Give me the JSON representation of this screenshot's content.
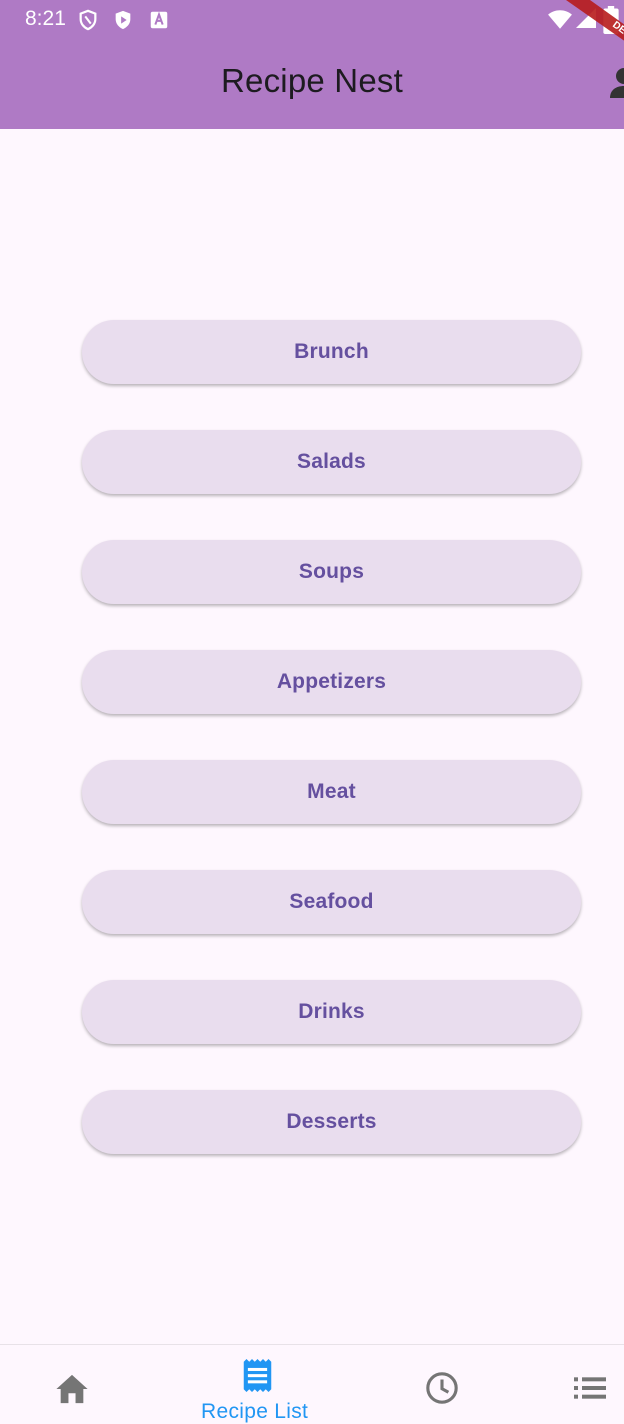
{
  "status_bar": {
    "time": "8:21",
    "icons": [
      "shield-icon",
      "play-protect-icon",
      "font-icon",
      "wifi-icon",
      "signal-icon",
      "battery-icon"
    ]
  },
  "debug_ribbon": {
    "label": "DEBUG"
  },
  "app_bar": {
    "title": "Recipe Nest",
    "background_color": "#AF7AC5",
    "profile_icon": "person-icon"
  },
  "categories": {
    "button_color": "#E9DDEE",
    "text_color": "#65509F",
    "items": [
      {
        "label": "Brunch"
      },
      {
        "label": "Salads"
      },
      {
        "label": "Soups"
      },
      {
        "label": "Appetizers"
      },
      {
        "label": "Meat"
      },
      {
        "label": "Seafood"
      },
      {
        "label": "Drinks"
      },
      {
        "label": "Desserts"
      }
    ]
  },
  "bottom_nav": {
    "selected_color": "#2196F3",
    "unselected_color": "#757575",
    "items": [
      {
        "icon": "home-icon",
        "label": ""
      },
      {
        "icon": "receipt-icon",
        "label": "Recipe List",
        "selected": true
      },
      {
        "icon": "clock-icon",
        "label": ""
      },
      {
        "icon": "list-icon",
        "label": ""
      }
    ]
  }
}
